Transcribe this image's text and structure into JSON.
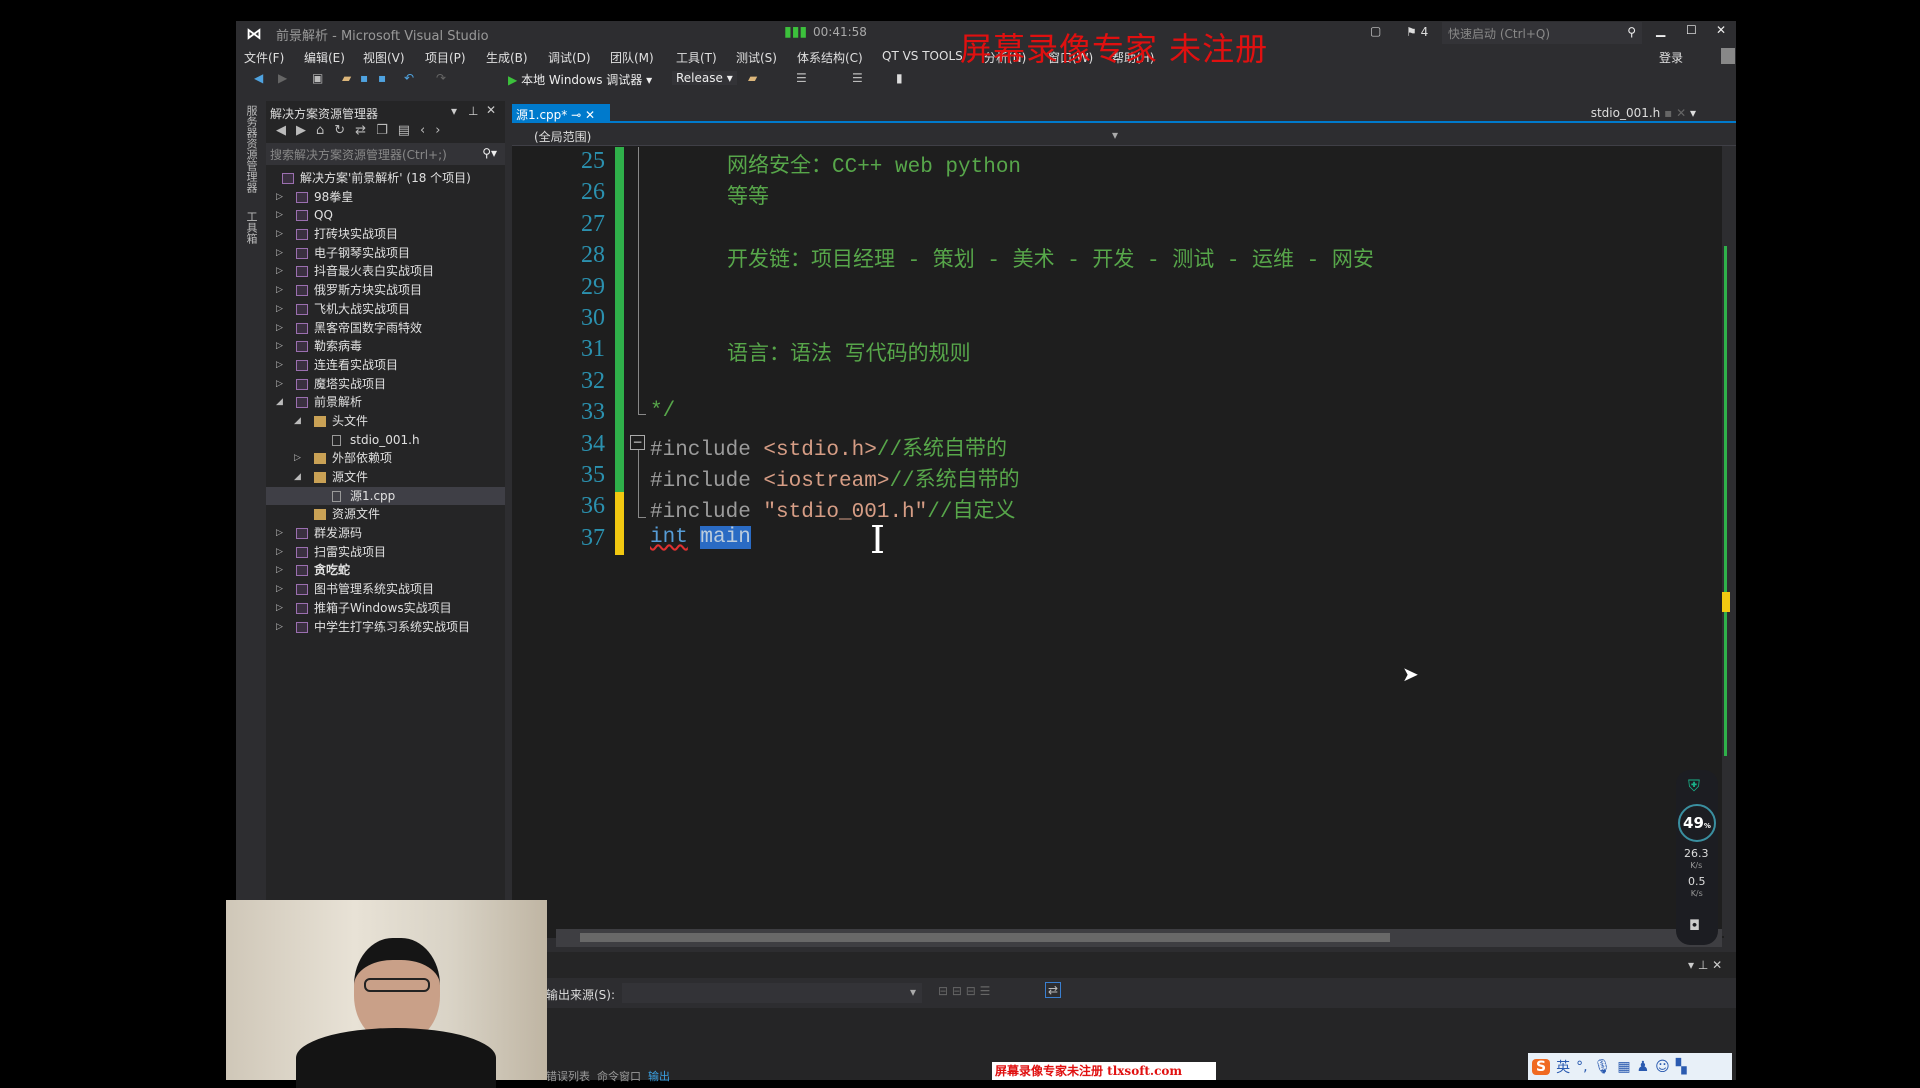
{
  "window": {
    "title": "前景解析 - Microsoft Visual Studio",
    "clock": "00:41:58",
    "notifications": "4",
    "quick_launch_placeholder": "快速启动 (Ctrl+Q)",
    "login": "登录"
  },
  "menu": [
    "文件(F)",
    "编辑(E)",
    "视图(V)",
    "项目(P)",
    "生成(B)",
    "调试(D)",
    "团队(M)",
    "工具(T)",
    "测试(S)",
    "体系结构(C)",
    "QT VS TOOLS",
    "分析(N)",
    "窗口(W)",
    "帮助(H)"
  ],
  "toolbar": {
    "run_label": "本地 Windows 调试器",
    "config": "Release"
  },
  "side_strip": {
    "server_explorer": "服务器资源管理器",
    "toolbox": "工具箱"
  },
  "solution_explorer": {
    "title": "解决方案资源管理器",
    "search_placeholder": "搜索解决方案资源管理器(Ctrl+;)",
    "nodes": [
      {
        "label": "解决方案'前景解析' (18 个项目)",
        "level": 0,
        "type": "solution"
      },
      {
        "label": "98拳皇",
        "level": 1,
        "type": "project",
        "state": "collapsed"
      },
      {
        "label": "QQ",
        "level": 1,
        "type": "project",
        "state": "collapsed"
      },
      {
        "label": "打砖块实战项目",
        "level": 1,
        "type": "project",
        "state": "collapsed"
      },
      {
        "label": "电子钢琴实战项目",
        "level": 1,
        "type": "project",
        "state": "collapsed"
      },
      {
        "label": "抖音最火表白实战项目",
        "level": 1,
        "type": "project",
        "state": "collapsed"
      },
      {
        "label": "俄罗斯方块实战项目",
        "level": 1,
        "type": "project",
        "state": "collapsed"
      },
      {
        "label": "飞机大战实战项目",
        "level": 1,
        "type": "project",
        "state": "collapsed"
      },
      {
        "label": "黑客帝国数字雨特效",
        "level": 1,
        "type": "project",
        "state": "collapsed"
      },
      {
        "label": "勒索病毒",
        "level": 1,
        "type": "project",
        "state": "collapsed"
      },
      {
        "label": "连连看实战项目",
        "level": 1,
        "type": "project",
        "state": "collapsed"
      },
      {
        "label": "魔塔实战项目",
        "level": 1,
        "type": "project",
        "state": "collapsed"
      },
      {
        "label": "前景解析",
        "level": 1,
        "type": "project",
        "state": "expanded"
      },
      {
        "label": "头文件",
        "level": 2,
        "type": "folder",
        "state": "expanded"
      },
      {
        "label": "stdio_001.h",
        "level": 3,
        "type": "file"
      },
      {
        "label": "外部依赖项",
        "level": 2,
        "type": "folder",
        "state": "collapsed"
      },
      {
        "label": "源文件",
        "level": 2,
        "type": "folder",
        "state": "expanded"
      },
      {
        "label": "源1.cpp",
        "level": 3,
        "type": "file",
        "selected": true
      },
      {
        "label": "资源文件",
        "level": 2,
        "type": "folder"
      },
      {
        "label": "群发源码",
        "level": 1,
        "type": "project",
        "state": "collapsed"
      },
      {
        "label": "扫雷实战项目",
        "level": 1,
        "type": "project",
        "state": "collapsed"
      },
      {
        "label": "贪吃蛇",
        "level": 1,
        "type": "project",
        "state": "collapsed",
        "bold": true
      },
      {
        "label": "图书管理系统实战项目",
        "level": 1,
        "type": "project",
        "state": "collapsed"
      },
      {
        "label": "推箱子Windows实战项目",
        "level": 1,
        "type": "project",
        "state": "collapsed"
      },
      {
        "label": "中学生打字练习系统实战项目",
        "level": 1,
        "type": "project",
        "state": "collapsed"
      }
    ]
  },
  "editor": {
    "active_tab": "源1.cpp*",
    "other_tab": "stdio_001.h",
    "scope": "(全局范围)",
    "lines": [
      {
        "n": "25",
        "text": "网络安全：CC++ web python",
        "cls": "cm",
        "indent": true
      },
      {
        "n": "26",
        "text": "等等",
        "cls": "cm",
        "indent": true
      },
      {
        "n": "27",
        "text": "",
        "cls": "cm"
      },
      {
        "n": "28",
        "text": "开发链：项目经理 - 策划 - 美术 - 开发 - 测试 - 运维 - 网安",
        "cls": "cm",
        "indent": true
      },
      {
        "n": "29",
        "text": "",
        "cls": "cm"
      },
      {
        "n": "30",
        "text": "",
        "cls": "cm"
      },
      {
        "n": "31",
        "text": "语言：语法 写代码的规则",
        "cls": "cm",
        "indent": true
      },
      {
        "n": "32",
        "text": "",
        "cls": "cm"
      },
      {
        "n": "33",
        "text": "*/",
        "cls": "cm"
      },
      {
        "n": "34",
        "pp": "#include ",
        "str": "<stdio.h>",
        "cm": "//系统自带的"
      },
      {
        "n": "35",
        "pp": "#include ",
        "str": "<iostream>",
        "cm": "//系统自带的"
      },
      {
        "n": "36",
        "pp": "#include ",
        "str": "\"stdio_001.h\"",
        "cm": "//自定义"
      },
      {
        "n": "37",
        "kw": "int",
        "sel": "main"
      }
    ],
    "colors": {
      "comment": "#57a64a",
      "keyword": "#569cd6",
      "string": "#d69d85",
      "line_number": "#2b91af",
      "saved_bar": "#2fb04a",
      "changed_bar": "#f2c811"
    }
  },
  "output": {
    "source_label": "输出来源(S):",
    "tabs": [
      "错误列表",
      "命令窗口",
      "输出"
    ]
  },
  "overlay": {
    "watermark": "屏幕录像专家  未注册",
    "watermark_bottom": "屏幕录像专家未注册 tlxsoft.com",
    "cpu_percent": "49",
    "pct": "%",
    "up_speed": "26.3",
    "down_speed": "0.5",
    "speed_unit": "K/s",
    "ime_lang": "英"
  }
}
